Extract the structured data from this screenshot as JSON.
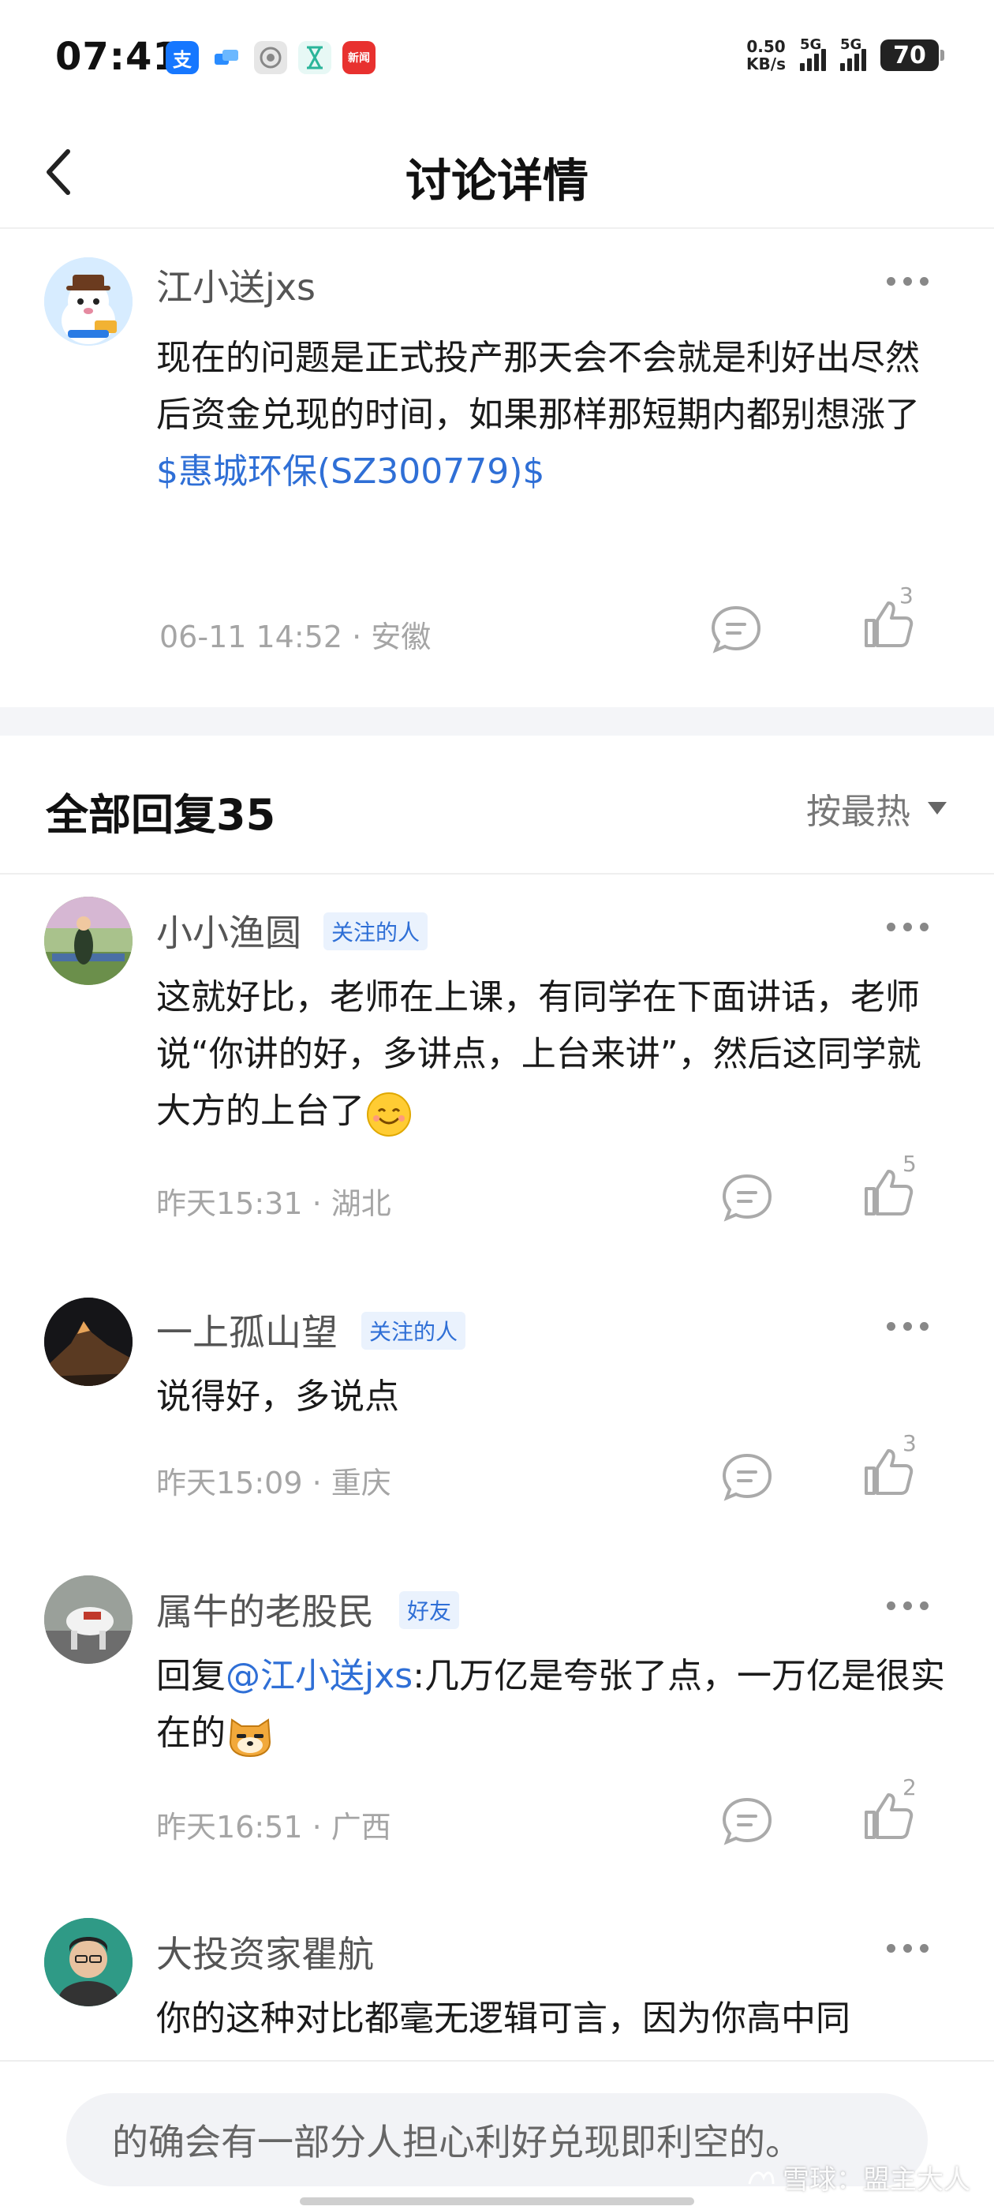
{
  "status_bar": {
    "time": "07:41",
    "net_speed_top": "0.50",
    "net_speed_bottom": "KB/s",
    "sim1": "5G",
    "sim2": "5G",
    "battery": "70",
    "app_icons": [
      "alipay-icon",
      "cloud-icon",
      "camera-icon",
      "hourglass-icon",
      "news-icon"
    ]
  },
  "nav": {
    "title": "讨论详情"
  },
  "post": {
    "author": "江小送jxs",
    "text": "现在的问题是正式投产那天会不会就是利好出尽然后资金兑现的时间，如果那样那短期内都别想涨了",
    "stock_link": "$惠城环保(SZ300779)$",
    "meta": "06-11 14:52 · 安徽",
    "likes": "3"
  },
  "replies_header": {
    "title": "全部回复35",
    "sort": "按最热"
  },
  "replies": [
    {
      "author": "小小渔圆",
      "tag": "关注的人",
      "text": "这就好比，老师在上课，有同学在下面讲话，老师说“你讲的好，多讲点，上台来讲”，然后这同学就大方的上台了",
      "meta": "昨天15:31 · 湖北",
      "likes": "5"
    },
    {
      "author": "一上孤山望",
      "tag": "关注的人",
      "text": "说得好，多说点",
      "meta": "昨天15:09 · 重庆",
      "likes": "3"
    },
    {
      "author": "属牛的老股民",
      "tag": "好友",
      "reply_prefix": "回复",
      "mention": "@江小送jxs",
      "text": ":几万亿是夸张了点，一万亿是很实在的",
      "meta": "昨天16:51 · 广西",
      "likes": "2"
    },
    {
      "author": "大投资家瞿航",
      "text": "你的这种对比都毫无逻辑可言，因为你高中同"
    }
  ],
  "bottom": {
    "input_placeholder": "的确会有一部分人担心利好兑现即利空的。",
    "watermark": "雪球：盟主大人"
  },
  "colors": {
    "link": "#2f6fd6",
    "tag_bg": "#eaf2fd",
    "meta": "#a5a5a5"
  }
}
